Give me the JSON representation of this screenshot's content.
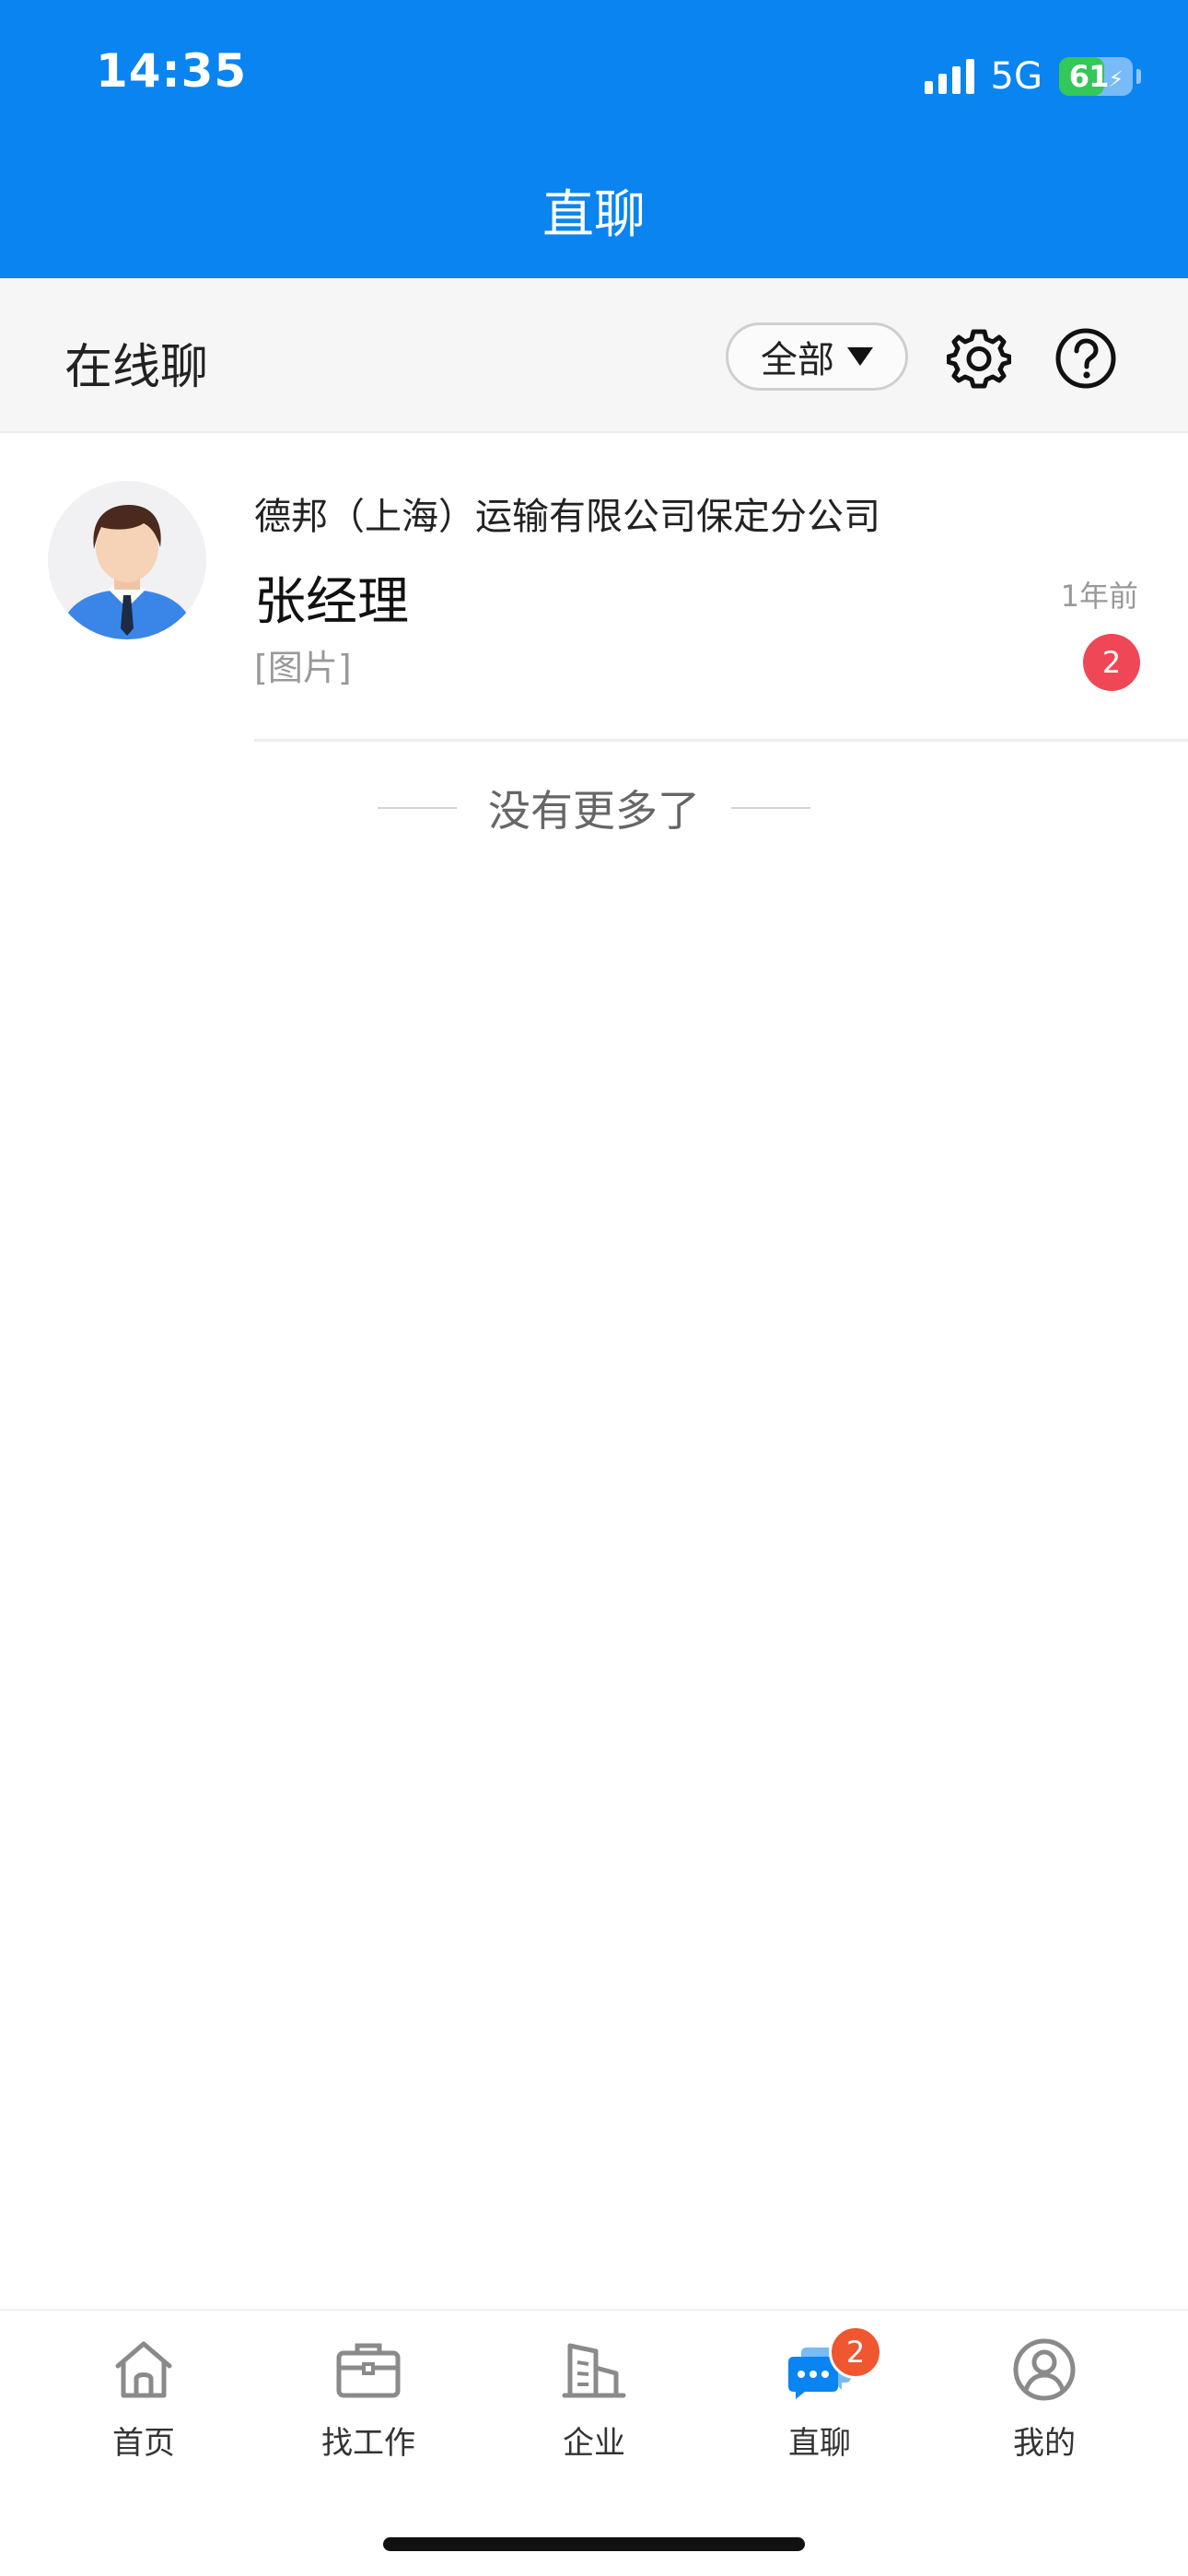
{
  "status_bar": {
    "time": "14:35",
    "network": "5G",
    "battery": "61",
    "battery_level": 0.61
  },
  "header": {
    "title": "直聊"
  },
  "subheader": {
    "title": "在线聊",
    "filter_label": "全部",
    "icons": [
      "settings-icon",
      "help-icon"
    ]
  },
  "conversations": [
    {
      "company": "德邦（上海）运输有限公司保定分公司",
      "name": "张经理",
      "time": "1年前",
      "preview": "[图片]",
      "unread": "2"
    }
  ],
  "list_footer": "没有更多了",
  "tabbar": {
    "items": [
      {
        "label": "首页",
        "icon": "home-icon"
      },
      {
        "label": "找工作",
        "icon": "briefcase-icon"
      },
      {
        "label": "企业",
        "icon": "building-icon"
      },
      {
        "label": "直聊",
        "icon": "chat-icon",
        "badge": "2",
        "active": true
      },
      {
        "label": "我的",
        "icon": "profile-icon"
      }
    ]
  },
  "colors": {
    "primary": "#0a84f0",
    "badge_red": "#f04757",
    "tab_badge": "#f0562f",
    "battery_green": "#34c759"
  }
}
